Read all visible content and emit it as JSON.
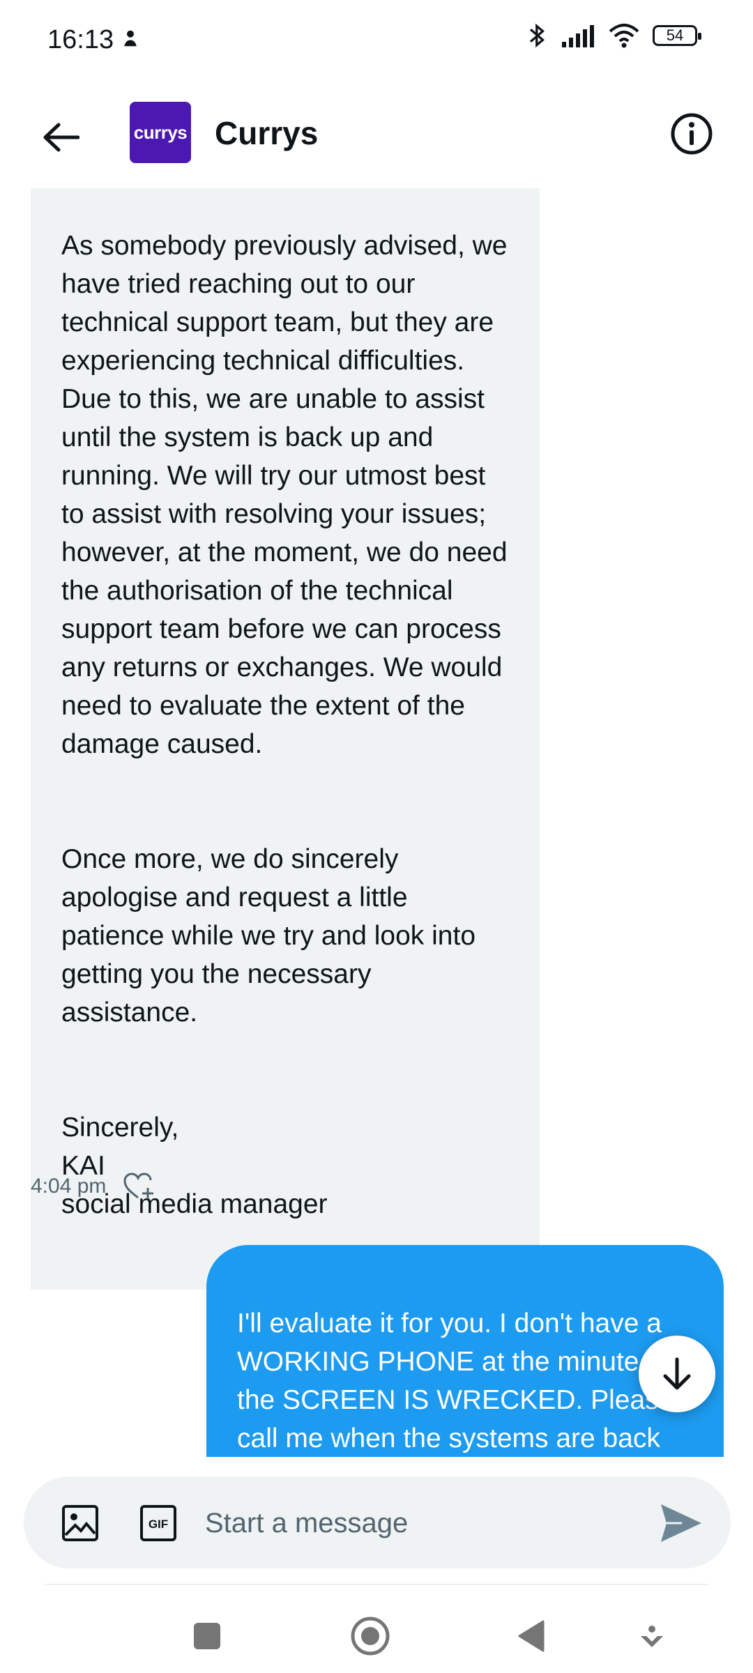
{
  "status_bar": {
    "time": "16:13",
    "battery": "54"
  },
  "header": {
    "avatar_text": "currys",
    "contact_name": "Currys"
  },
  "messages": {
    "incoming_paragraphs": [
      "As somebody previously advised, we have tried reaching out to our technical support team, but they are experiencing technical difficulties. Due to this, we are unable to assist until the system is back up and running. We will try our utmost best to assist with resolving your issues; however, at the moment, we do need the authorisation of the technical support team before we can process any returns or exchanges. We would need to evaluate the extent of the damage caused.",
      "Once more, we do sincerely apologise and request a little patience while we try and look into getting you the necessary assistance.",
      "Sincerely,\nKAI\nsocial media manager"
    ],
    "incoming_time": "4:04 pm",
    "outgoing_text": "I'll evaluate it for you. I don't have a WORKING PHONE at the minute and the SCREEN IS WRECKED. Please call me when the systems are back up"
  },
  "composer": {
    "placeholder": "Start a message",
    "gif_label": "GIF"
  },
  "colors": {
    "brand_avatar": "#4b18b1",
    "outgoing_bubble": "#1d9bf0",
    "incoming_bubble": "#eff3f4"
  },
  "icons": [
    "back-arrow-icon",
    "info-icon",
    "heart-plus-icon",
    "arrow-down-icon",
    "image-icon",
    "gif-icon",
    "send-icon"
  ]
}
